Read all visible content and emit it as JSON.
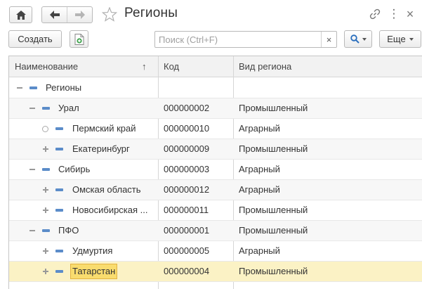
{
  "window": {
    "title": "Регионы"
  },
  "toolbar": {
    "create_label": "Создать",
    "more_label": "Еще",
    "search_placeholder": "Поиск (Ctrl+F)",
    "search_value": "",
    "clear_glyph": "×",
    "more_glyph": "⋮",
    "close_glyph": "×",
    "sort_glyph": "↑"
  },
  "icons": {
    "home": "home-icon",
    "back": "arrow-left-icon",
    "forward": "arrow-right-icon",
    "favorite": "star-icon",
    "link": "link-icon",
    "more": "more-vertical-icon",
    "close": "close-icon",
    "create_copy": "document-add-icon",
    "find": "search-icon"
  },
  "colors": {
    "item_icon": "#5b8cc9",
    "selected_row": "#fbf2c5",
    "selected_cell": "#f9dc6e",
    "add_icon": "#3fa34d"
  },
  "table": {
    "columns": [
      "Наименование",
      "Код",
      "Вид региона"
    ],
    "rows": [
      {
        "name": "Регионы",
        "code": "",
        "kind": "",
        "toggle": "minus",
        "level": 0,
        "selected": false
      },
      {
        "name": "Урал",
        "code": "000000002",
        "kind": "Промышленный",
        "toggle": "minus",
        "level": 1,
        "selected": false
      },
      {
        "name": "Пермский край",
        "code": "000000010",
        "kind": "Аграрный",
        "toggle": "circle",
        "level": 2,
        "selected": false
      },
      {
        "name": "Екатеринбург",
        "code": "000000009",
        "kind": "Промышленный",
        "toggle": "plus",
        "level": 2,
        "selected": false
      },
      {
        "name": "Сибирь",
        "code": "000000003",
        "kind": "Аграрный",
        "toggle": "minus",
        "level": 1,
        "selected": false
      },
      {
        "name": "Омская область",
        "code": "000000012",
        "kind": "Аграрный",
        "toggle": "plus",
        "level": 2,
        "selected": false
      },
      {
        "name": "Новосибирская ...",
        "code": "000000011",
        "kind": "Промышленный",
        "toggle": "plus",
        "level": 2,
        "selected": false
      },
      {
        "name": "ПФО",
        "code": "000000001",
        "kind": "Промышленный",
        "toggle": "minus",
        "level": 1,
        "selected": false
      },
      {
        "name": "Удмуртия",
        "code": "000000005",
        "kind": "Аграрный",
        "toggle": "plus",
        "level": 2,
        "selected": false
      },
      {
        "name": "Татарстан",
        "code": "000000004",
        "kind": "Промышленный",
        "toggle": "plus",
        "level": 2,
        "selected": true
      }
    ]
  }
}
